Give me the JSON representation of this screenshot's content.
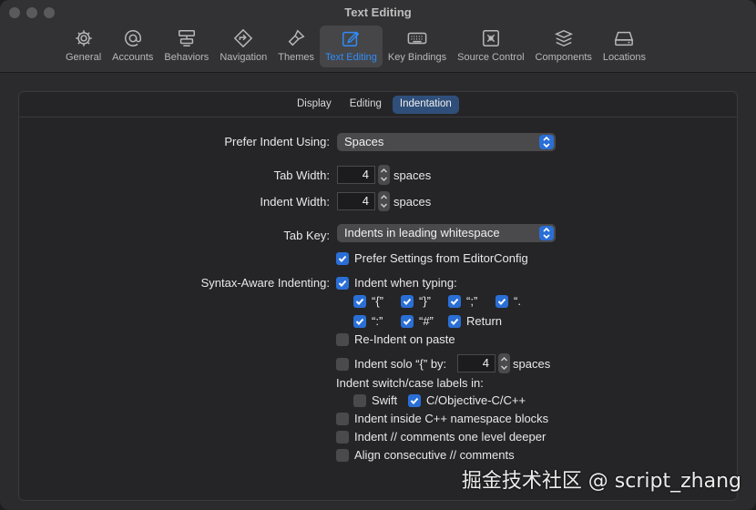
{
  "window": {
    "title": "Text Editing"
  },
  "toolbar": [
    {
      "label": "General",
      "icon": "gear-icon"
    },
    {
      "label": "Accounts",
      "icon": "at-icon"
    },
    {
      "label": "Behaviors",
      "icon": "behaviors-icon"
    },
    {
      "label": "Navigation",
      "icon": "navigation-icon"
    },
    {
      "label": "Themes",
      "icon": "brush-icon"
    },
    {
      "label": "Text Editing",
      "icon": "pencil-square-icon",
      "active": true
    },
    {
      "label": "Key Bindings",
      "icon": "keyboard-icon"
    },
    {
      "label": "Source Control",
      "icon": "source-control-icon"
    },
    {
      "label": "Components",
      "icon": "components-icon"
    },
    {
      "label": "Locations",
      "icon": "drive-icon"
    }
  ],
  "tabs": [
    {
      "label": "Display"
    },
    {
      "label": "Editing"
    },
    {
      "label": "Indentation",
      "active": true
    }
  ],
  "form": {
    "prefer_indent_label": "Prefer Indent Using:",
    "prefer_indent_value": "Spaces",
    "tab_width_label": "Tab Width:",
    "tab_width_value": "4",
    "tab_width_unit": "spaces",
    "indent_width_label": "Indent Width:",
    "indent_width_value": "4",
    "indent_width_unit": "spaces",
    "tab_key_label": "Tab Key:",
    "tab_key_value": "Indents in leading whitespace",
    "editorconfig": "Prefer Settings from EditorConfig",
    "syntax_label": "Syntax-Aware Indenting:",
    "indent_when_typing": "Indent when typing:",
    "chars_row1": [
      "“{”",
      "“}”",
      "“;”",
      "“."
    ],
    "chars_row2": [
      "“:”",
      "“#”",
      "Return"
    ],
    "reindent": "Re-Indent on paste",
    "indent_solo": "Indent solo “{” by:",
    "indent_solo_value": "4",
    "indent_solo_unit": "spaces",
    "switch_case_label": "Indent switch/case labels in:",
    "swift": "Swift",
    "c_objc": "C/Objective-C/C++",
    "cpp_namespace": "Indent inside C++ namespace blocks",
    "comments_deeper": "Indent // comments one level deeper",
    "align_comments": "Align consecutive // comments"
  },
  "watermark": "掘金技术社区 @ script_zhang",
  "colors": {
    "accent": "#2a6fd6",
    "active_tab": "#2f4f7a",
    "toolbar_active_text": "#2f8cf8"
  }
}
